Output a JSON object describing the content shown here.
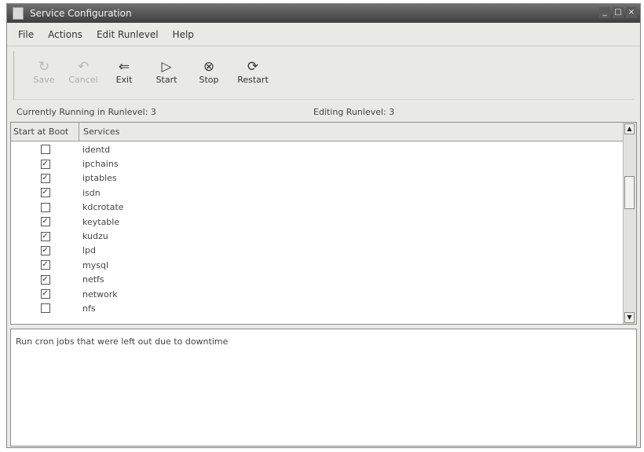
{
  "window": {
    "title": "Service Configuration",
    "buttons": [
      "_",
      "□",
      "×"
    ]
  },
  "menu": [
    "File",
    "Actions",
    "Edit Runlevel",
    "Help"
  ],
  "toolbar": [
    {
      "label": "Save",
      "icon": "save-icon",
      "glyph": "↻",
      "enabled": false
    },
    {
      "label": "Cancel",
      "icon": "undo-icon",
      "glyph": "↶",
      "enabled": false
    },
    {
      "label": "Exit",
      "icon": "exit-icon",
      "glyph": "⇐",
      "enabled": true
    },
    {
      "label": "Start",
      "icon": "start-icon",
      "glyph": "▷",
      "enabled": true
    },
    {
      "label": "Stop",
      "icon": "stop-icon",
      "glyph": "⊗",
      "enabled": true
    },
    {
      "label": "Restart",
      "icon": "restart-icon",
      "glyph": "⟳",
      "enabled": true
    }
  ],
  "status": {
    "running": "Currently Running in Runlevel: 3",
    "editing": "Editing Runlevel: 3"
  },
  "list": {
    "headers": {
      "start_at_boot": "Start at Boot",
      "services": "Services"
    },
    "rows": [
      {
        "name": "identd",
        "checked": false
      },
      {
        "name": "ipchains",
        "checked": true
      },
      {
        "name": "iptables",
        "checked": true
      },
      {
        "name": "isdn",
        "checked": true
      },
      {
        "name": "kdcrotate",
        "checked": false
      },
      {
        "name": "keytable",
        "checked": true
      },
      {
        "name": "kudzu",
        "checked": true
      },
      {
        "name": "lpd",
        "checked": true
      },
      {
        "name": "mysql",
        "checked": true
      },
      {
        "name": "netfs",
        "checked": true
      },
      {
        "name": "network",
        "checked": true
      },
      {
        "name": "nfs",
        "checked": false
      }
    ]
  },
  "description": "Run cron jobs that were left out due to downtime"
}
